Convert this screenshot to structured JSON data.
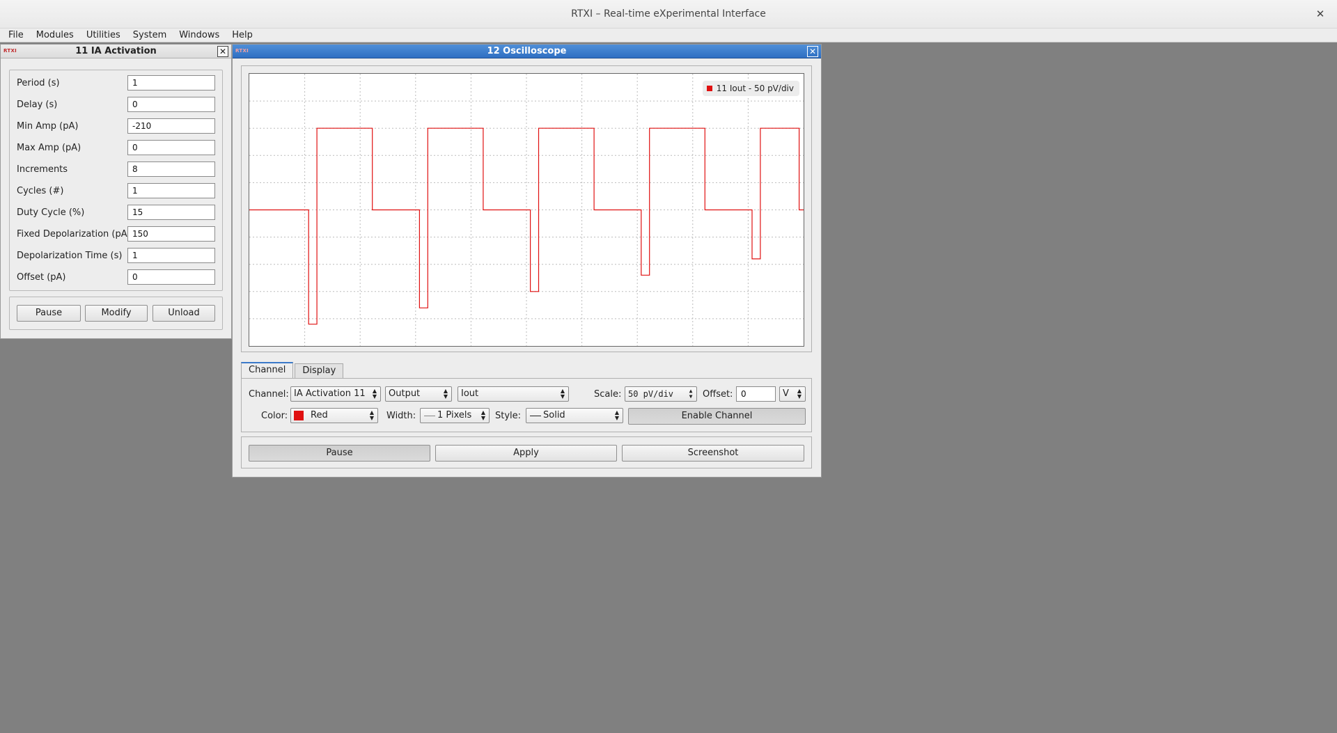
{
  "app": {
    "title": "RTXI – Real-time eXperimental Interface",
    "close_glyph": "✕"
  },
  "menubar": [
    {
      "label": "File"
    },
    {
      "label": "Modules"
    },
    {
      "label": "Utilities"
    },
    {
      "label": "System"
    },
    {
      "label": "Windows"
    },
    {
      "label": "Help"
    }
  ],
  "ia_window": {
    "logo": "RTXI",
    "title": "11 IA Activation",
    "close_glyph": "✕",
    "params": [
      {
        "label": "Period (s)",
        "value": "1"
      },
      {
        "label": "Delay (s)",
        "value": "0"
      },
      {
        "label": "Min Amp (pA)",
        "value": "-210"
      },
      {
        "label": "Max Amp (pA)",
        "value": "0"
      },
      {
        "label": "Increments",
        "value": "8"
      },
      {
        "label": "Cycles (#)",
        "value": "1"
      },
      {
        "label": "Duty Cycle (%)",
        "value": "15"
      },
      {
        "label": "Fixed Depolarization (pA)",
        "value": "150"
      },
      {
        "label": "Depolarization Time (s)",
        "value": "1"
      },
      {
        "label": "Offset (pA)",
        "value": "0"
      }
    ],
    "buttons": {
      "pause": "Pause",
      "modify": "Modify",
      "unload": "Unload"
    }
  },
  "osc_window": {
    "logo": "RTXI",
    "title": "12 Oscilloscope",
    "close_glyph": "✕",
    "legend": {
      "label": "11 Iout - 50 pV/div",
      "color": "#e01010"
    },
    "tabs": [
      {
        "label": "Channel"
      },
      {
        "label": "Display"
      }
    ],
    "channel": {
      "channel_label": "Channel:",
      "block_value": "IA Activation 11",
      "type_value": "Output",
      "signal_value": "Iout",
      "scale_label": "Scale:",
      "scale_value": "50 pV/div",
      "offset_label": "Offset:",
      "offset_value": "0",
      "offset_unit": "V",
      "color_label": "Color:",
      "color_value": "Red",
      "width_label": "Width:",
      "width_value": "1 Pixels",
      "style_label": "Style:",
      "style_value": "Solid",
      "enable_button": "Enable Channel"
    },
    "buttons": {
      "pause": "Pause",
      "apply": "Apply",
      "screenshot": "Screenshot"
    }
  },
  "chart_data": {
    "type": "line",
    "title": "",
    "xlabel": "",
    "ylabel": "",
    "grid": true,
    "xlim": [
      0,
      10
    ],
    "ylim": [
      -5,
      5
    ],
    "series": [
      {
        "name": "11 Iout - 50 pV/div",
        "color": "#e01010",
        "x": [
          0,
          1.07,
          1.07,
          1.22,
          1.22,
          2.22,
          2.22,
          3.07,
          3.07,
          3.22,
          3.22,
          4.22,
          4.22,
          5.07,
          5.07,
          5.22,
          5.22,
          6.22,
          6.22,
          7.07,
          7.07,
          7.22,
          7.22,
          8.22,
          8.22,
          9.07,
          9.07,
          9.22,
          9.22,
          9.92,
          9.92,
          10
        ],
        "y": [
          0,
          0,
          -4.2,
          -4.2,
          3,
          3,
          0,
          0,
          -3.6,
          -3.6,
          3,
          3,
          0,
          0,
          -3,
          -3,
          3,
          3,
          0,
          0,
          -2.4,
          -2.4,
          3,
          3,
          0,
          0,
          -1.8,
          -1.8,
          3,
          3,
          0,
          0
        ]
      }
    ]
  }
}
